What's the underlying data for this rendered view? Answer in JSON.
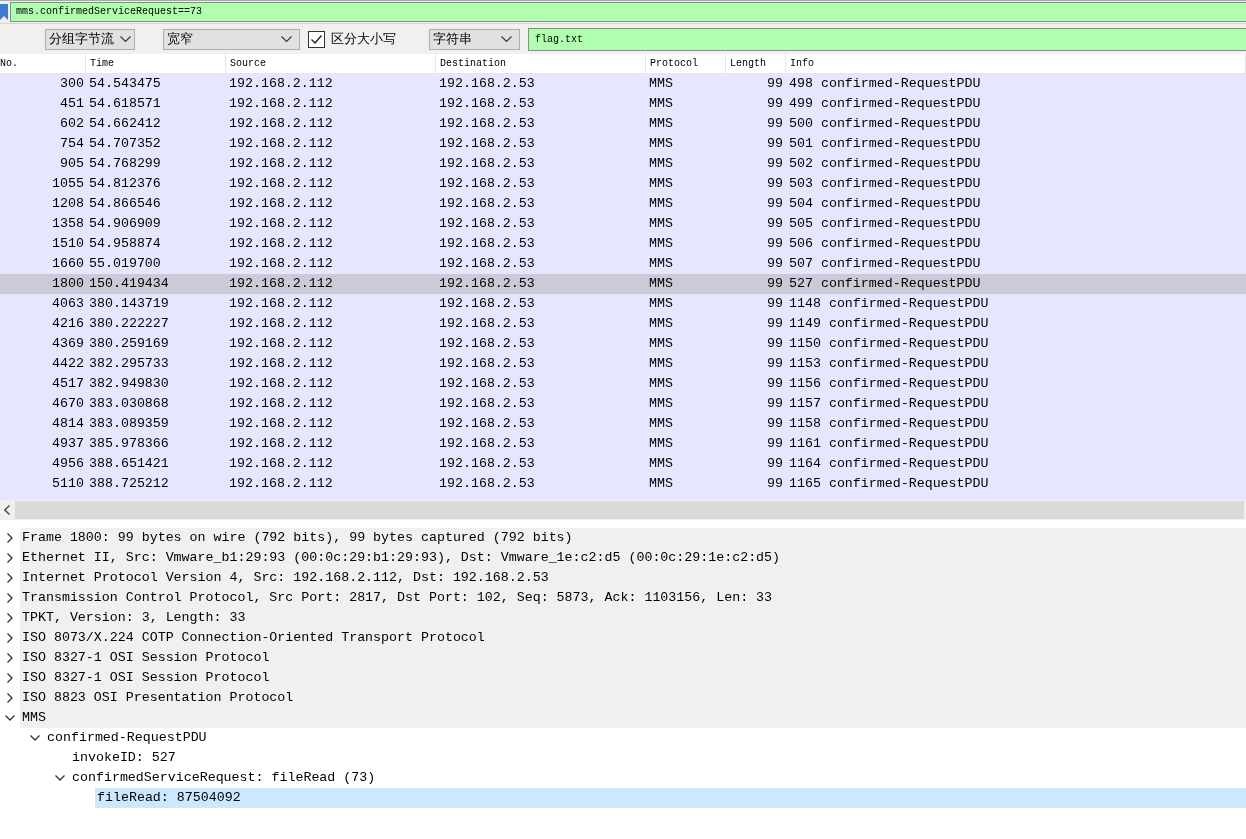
{
  "display_filter": {
    "value": "mms.confirmedServiceRequest==73"
  },
  "find_bar": {
    "search_in": "分组字节流",
    "character_width": "宽窄",
    "case_sensitive": {
      "label": "区分大小写",
      "checked": true
    },
    "search_type": "字符串",
    "search_value": "flag.txt"
  },
  "packet_list": {
    "columns": [
      "No.",
      "Time",
      "Source",
      "Destination",
      "Protocol",
      "Length",
      "Info"
    ],
    "rows": [
      {
        "cells": [
          "300",
          "54.543475",
          "192.168.2.112",
          "192.168.2.53",
          "MMS",
          "99",
          "498 confirmed-RequestPDU"
        ],
        "selected": false
      },
      {
        "cells": [
          "451",
          "54.618571",
          "192.168.2.112",
          "192.168.2.53",
          "MMS",
          "99",
          "499 confirmed-RequestPDU"
        ],
        "selected": false
      },
      {
        "cells": [
          "602",
          "54.662412",
          "192.168.2.112",
          "192.168.2.53",
          "MMS",
          "99",
          "500 confirmed-RequestPDU"
        ],
        "selected": false
      },
      {
        "cells": [
          "754",
          "54.707352",
          "192.168.2.112",
          "192.168.2.53",
          "MMS",
          "99",
          "501 confirmed-RequestPDU"
        ],
        "selected": false
      },
      {
        "cells": [
          "905",
          "54.768299",
          "192.168.2.112",
          "192.168.2.53",
          "MMS",
          "99",
          "502 confirmed-RequestPDU"
        ],
        "selected": false
      },
      {
        "cells": [
          "1055",
          "54.812376",
          "192.168.2.112",
          "192.168.2.53",
          "MMS",
          "99",
          "503 confirmed-RequestPDU"
        ],
        "selected": false
      },
      {
        "cells": [
          "1208",
          "54.866546",
          "192.168.2.112",
          "192.168.2.53",
          "MMS",
          "99",
          "504 confirmed-RequestPDU"
        ],
        "selected": false
      },
      {
        "cells": [
          "1358",
          "54.906909",
          "192.168.2.112",
          "192.168.2.53",
          "MMS",
          "99",
          "505 confirmed-RequestPDU"
        ],
        "selected": false
      },
      {
        "cells": [
          "1510",
          "54.958874",
          "192.168.2.112",
          "192.168.2.53",
          "MMS",
          "99",
          "506 confirmed-RequestPDU"
        ],
        "selected": false
      },
      {
        "cells": [
          "1660",
          "55.019700",
          "192.168.2.112",
          "192.168.2.53",
          "MMS",
          "99",
          "507 confirmed-RequestPDU"
        ],
        "selected": false
      },
      {
        "cells": [
          "1800",
          "150.419434",
          "192.168.2.112",
          "192.168.2.53",
          "MMS",
          "99",
          "527 confirmed-RequestPDU"
        ],
        "selected": true
      },
      {
        "cells": [
          "4063",
          "380.143719",
          "192.168.2.112",
          "192.168.2.53",
          "MMS",
          "99",
          "1148 confirmed-RequestPDU"
        ],
        "selected": false
      },
      {
        "cells": [
          "4216",
          "380.222227",
          "192.168.2.112",
          "192.168.2.53",
          "MMS",
          "99",
          "1149 confirmed-RequestPDU"
        ],
        "selected": false
      },
      {
        "cells": [
          "4369",
          "380.259169",
          "192.168.2.112",
          "192.168.2.53",
          "MMS",
          "99",
          "1150 confirmed-RequestPDU"
        ],
        "selected": false
      },
      {
        "cells": [
          "4422",
          "382.295733",
          "192.168.2.112",
          "192.168.2.53",
          "MMS",
          "99",
          "1153 confirmed-RequestPDU"
        ],
        "selected": false
      },
      {
        "cells": [
          "4517",
          "382.949830",
          "192.168.2.112",
          "192.168.2.53",
          "MMS",
          "99",
          "1156 confirmed-RequestPDU"
        ],
        "selected": false
      },
      {
        "cells": [
          "4670",
          "383.030868",
          "192.168.2.112",
          "192.168.2.53",
          "MMS",
          "99",
          "1157 confirmed-RequestPDU"
        ],
        "selected": false
      },
      {
        "cells": [
          "4814",
          "383.089359",
          "192.168.2.112",
          "192.168.2.53",
          "MMS",
          "99",
          "1158 confirmed-RequestPDU"
        ],
        "selected": false
      },
      {
        "cells": [
          "4937",
          "385.978366",
          "192.168.2.112",
          "192.168.2.53",
          "MMS",
          "99",
          "1161 confirmed-RequestPDU"
        ],
        "selected": false
      },
      {
        "cells": [
          "4956",
          "388.651421",
          "192.168.2.112",
          "192.168.2.53",
          "MMS",
          "99",
          "1164 confirmed-RequestPDU"
        ],
        "selected": false
      },
      {
        "cells": [
          "5110",
          "388.725212",
          "192.168.2.112",
          "192.168.2.53",
          "MMS",
          "99",
          "1165 confirmed-RequestPDU"
        ],
        "selected": false
      }
    ]
  },
  "packet_details": [
    {
      "text": "Frame 1800: 99 bytes on wire (792 bits), 99 bytes captured (792 bits)",
      "kind": "branch",
      "expanded": false,
      "selected": false
    },
    {
      "text": "Ethernet II, Src: Vmware_b1:29:93 (00:0c:29:b1:29:93), Dst: Vmware_1e:c2:d5 (00:0c:29:1e:c2:d5)",
      "kind": "branch",
      "expanded": false,
      "selected": false
    },
    {
      "text": "Internet Protocol Version 4, Src: 192.168.2.112, Dst: 192.168.2.53",
      "kind": "branch",
      "expanded": false,
      "selected": false
    },
    {
      "text": "Transmission Control Protocol, Src Port: 2817, Dst Port: 102, Seq: 5873, Ack: 1103156, Len: 33",
      "kind": "branch",
      "expanded": false,
      "selected": false
    },
    {
      "text": "TPKT, Version: 3, Length: 33",
      "kind": "branch",
      "expanded": false,
      "selected": false
    },
    {
      "text": "ISO 8073/X.224 COTP Connection-Oriented Transport Protocol",
      "kind": "branch",
      "expanded": false,
      "selected": false
    },
    {
      "text": "ISO 8327-1 OSI Session Protocol",
      "kind": "branch",
      "expanded": false,
      "selected": false
    },
    {
      "text": "ISO 8327-1 OSI Session Protocol",
      "kind": "branch",
      "expanded": false,
      "selected": false
    },
    {
      "text": "ISO 8823 OSI Presentation Protocol",
      "kind": "branch",
      "expanded": false,
      "selected": false
    },
    {
      "text": "MMS",
      "kind": "branch",
      "expanded": true,
      "selected": false,
      "children": [
        {
          "text": "confirmed-RequestPDU",
          "kind": "branch",
          "expanded": true,
          "selected": false,
          "children": [
            {
              "text": "invokeID: 527",
              "kind": "leaf",
              "selected": false
            },
            {
              "text": "confirmedServiceRequest: fileRead (73)",
              "kind": "branch",
              "expanded": true,
              "selected": false,
              "children": [
                {
                  "text": "fileRead: 87504092",
                  "kind": "leaf",
                  "selected": true
                }
              ]
            }
          ]
        }
      ]
    }
  ]
}
